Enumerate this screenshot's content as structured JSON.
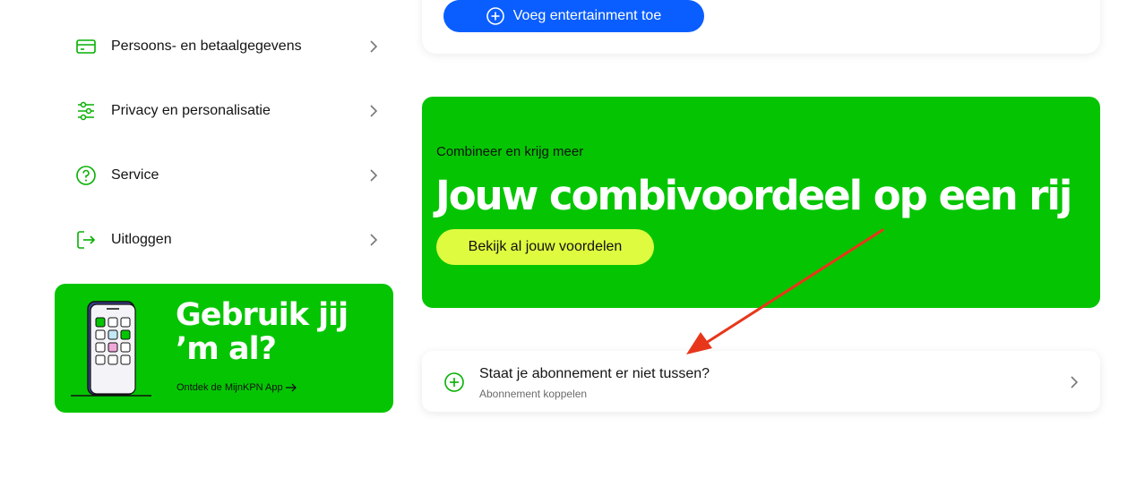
{
  "sidebar": {
    "items": [
      {
        "label": "Persoons- en betaalgegevens",
        "icon": "credit-card-icon"
      },
      {
        "label": "Privacy en personalisatie",
        "icon": "sliders-icon"
      },
      {
        "label": "Service",
        "icon": "question-circle-icon"
      },
      {
        "label": "Uitloggen",
        "icon": "logout-icon"
      }
    ]
  },
  "promo": {
    "title": "Gebruik jij ’m al?",
    "link": "Ontdek de MijnKPN App",
    "link_icon": "arrow-right-icon",
    "illustration": "phone-app-illustration"
  },
  "entertainment": {
    "button_label": "Voeg entertainment toe",
    "button_icon": "plus-circle-icon"
  },
  "combi": {
    "eyebrow": "Combineer en krijg meer",
    "title": "Jouw combivoordeel op een rij",
    "button_label": "Bekijk al jouw voordelen"
  },
  "subscription": {
    "title": "Staat je abonnement er niet tussen?",
    "subtitle": "Abonnement koppelen",
    "icon": "plus-circle-icon",
    "chevron": "chevron-right-icon"
  },
  "annotation": {
    "type": "red-arrow",
    "color": "#e8361a"
  },
  "colors": {
    "brand_green": "#05c502",
    "accent_blue": "#0a5eff",
    "lime": "#dffb3f",
    "icon_green": "#05b002"
  }
}
